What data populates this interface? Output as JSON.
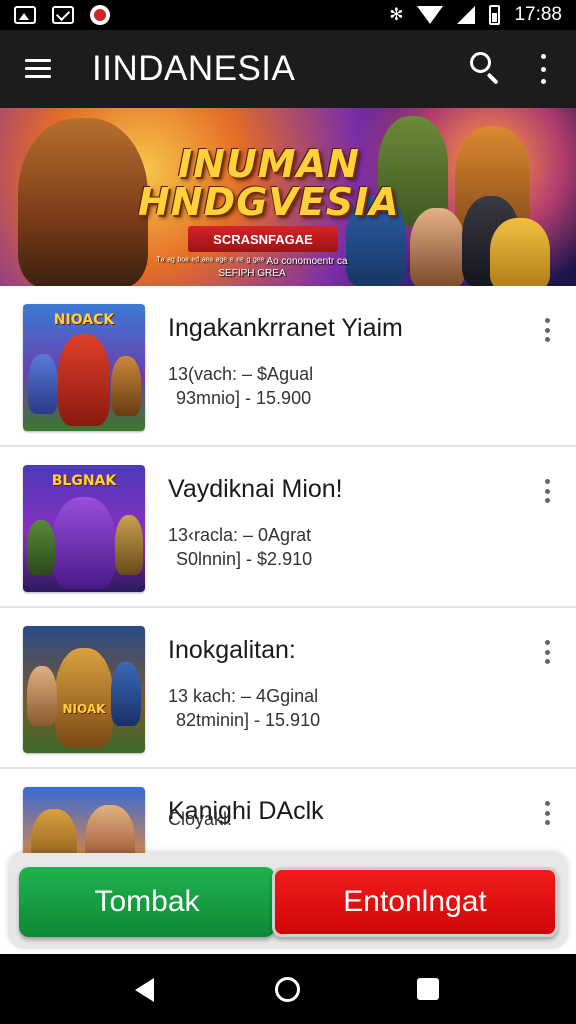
{
  "status_bar": {
    "time": "17:88",
    "icons": [
      "image-icon",
      "mail-icon",
      "youtube-icon",
      "bluetooth-icon",
      "wifi-icon",
      "signal-icon",
      "battery-icon"
    ],
    "bluetooth_glyph": "✻",
    "signal_sep": "⁄"
  },
  "app_bar": {
    "title": "IINDANESIA"
  },
  "banner": {
    "title_line1": "INUMAN",
    "title_line2": "HNDGVESIA",
    "ribbon": "SCRASNFAGAE",
    "subtitle": "ᵀᵃ ᵃᵍ ᵇᵒᵃ ᵉᵈ ᵃᵉᵃ ᵃᵍᵉ ᵉ ᵉᵉ ᵍ ᵍᵉᵉ Ao conomoentr ca SEFIPH GREA"
  },
  "games": [
    {
      "thumb_label": "NIOACK",
      "title": "Ingakankrranet Yiaim",
      "line1": "13(vach: – $Agual",
      "line2": "93mnio] - 15.900"
    },
    {
      "thumb_label": "BLGNAK",
      "title": "Vaydiknai Mion!",
      "line1": "13‹racla: – 0Agrat",
      "line2": "S0lnnin] - $2.910"
    },
    {
      "thumb_label": "NIOAK",
      "title": "Inokgalitan:",
      "line1": "13 kach: – 4Gginal",
      "line2": "82tminin] - 15.910"
    },
    {
      "thumb_label": "",
      "title": "Kanighi DAclk",
      "line1": "Cloyakl:",
      "line2": ""
    }
  ],
  "actions": {
    "primary": "Tombak",
    "secondary": "Entonlngat"
  },
  "colors": {
    "app_bar": "#1c1c1c",
    "primary_button": "#17a343",
    "secondary_button": "#e81313",
    "status_bar": "#000000"
  }
}
